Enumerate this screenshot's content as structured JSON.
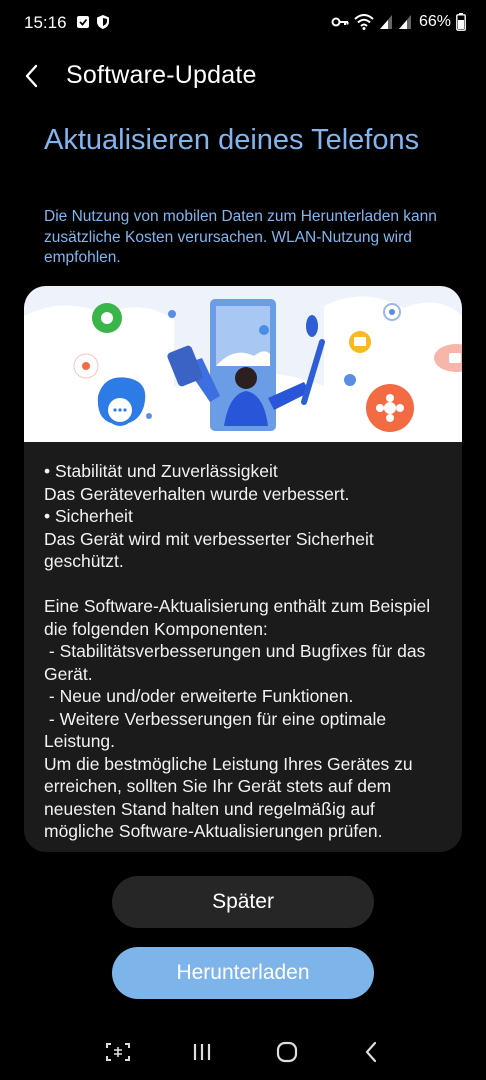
{
  "status_bar": {
    "time": "15:16",
    "battery": "66%",
    "icons": [
      "check-square-icon",
      "shield-icon",
      "key-icon",
      "wifi-icon",
      "signal-icon",
      "signal-icon",
      "battery-icon"
    ]
  },
  "header": {
    "title": "Software-Update",
    "back_icon": "chevron-left-icon"
  },
  "main": {
    "headline": "Aktualisieren deines Telefons",
    "info": "Die Nutzung von mobilen Daten zum Herunterladen kann zusätzliche Kosten verursachen. WLAN-Nutzung wird empfohlen.",
    "release_notes": "• Stabilität und Zuverlässigkeit\nDas Geräteverhalten wurde verbessert.\n• Sicherheit\nDas Gerät wird mit verbesserter Sicherheit geschützt.\n\nEine Software-Aktualisierung enthält zum Beispiel die folgenden Komponenten:\n - Stabilitätsverbesserungen und Bugfixes für das Gerät.\n - Neue und/oder erweiterte Funktionen.\n - Weitere Verbesserungen für eine optimale Leistung.\nUm die bestmögliche Leistung Ihres Gerätes zu erreichen, sollten Sie Ihr Gerät stets auf dem neuesten Stand halten und regelmäßig auf mögliche Software-Aktualisierungen prüfen."
  },
  "buttons": {
    "later": "Später",
    "download": "Herunterladen"
  },
  "nav_bar": {
    "icons": [
      "recent-apps-screenshot-icon",
      "recents-icon",
      "home-icon",
      "back-icon"
    ]
  },
  "colors": {
    "accent": "#82b5ef",
    "download_button": "#7db4ea",
    "card": "#1b1b1b",
    "secondary_button": "#262626"
  }
}
